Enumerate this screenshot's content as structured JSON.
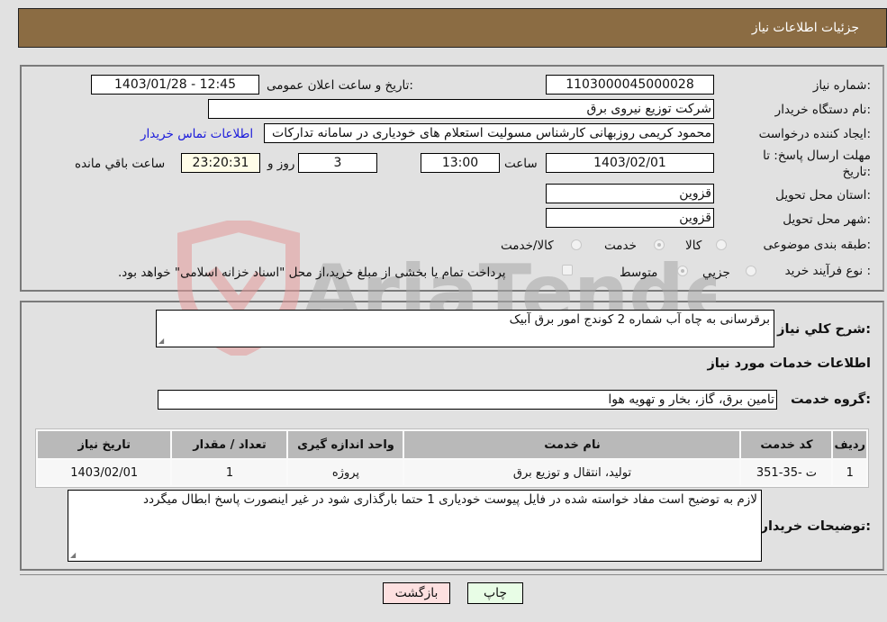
{
  "header": {
    "title": "جزئیات اطلاعات نیاز"
  },
  "fields": {
    "need_number": {
      "label": "شماره نیاز:",
      "value": "1103000045000028"
    },
    "announce_datetime": {
      "label": "تاریخ و ساعت اعلان عمومی:",
      "value": "1403/01/28 - 12:45"
    },
    "buyer_org": {
      "label": "نام دستگاه خریدار:",
      "value": "شرکت توزیع نیروی برق"
    },
    "requester": {
      "label": "ایجاد کننده درخواست:",
      "value": "محمود کریمی روزبهانی کارشناس  مسولیت استعلام های خودیاری در سامانه تدارکات",
      "link": "اطلاعات تماس خریدار"
    },
    "deadline": {
      "label": "مهلت ارسال پاسخ: تا تاریخ:",
      "date": "1403/02/01",
      "time_label": "ساعت",
      "time": "13:00",
      "days": "3",
      "days_label": "روز و",
      "remaining": "23:20:31",
      "remaining_label": "ساعت باقي مانده"
    },
    "province": {
      "label": "استان محل تحویل:",
      "value": "قزوین"
    },
    "city": {
      "label": "شهر محل تحویل:",
      "value": "قزوین"
    },
    "category": {
      "label": "طبقه بندی موضوعی:",
      "options": [
        {
          "label": "کالا",
          "checked": false
        },
        {
          "label": "خدمت",
          "checked": true
        },
        {
          "label": "کالا/خدمت",
          "checked": false
        }
      ]
    },
    "purchase_type": {
      "label": "نوع فرآیند خرید :",
      "options": [
        {
          "label": "جزيي",
          "checked": false
        },
        {
          "label": "متوسط",
          "checked": true
        }
      ],
      "checkbox_label": "پرداخت تمام یا بخشی از مبلغ خرید،از محل \"اسناد خزانه اسلامی\" خواهد بود.",
      "checkbox_checked": false
    }
  },
  "summary": {
    "label": "شرح کلي نیاز:",
    "value": "برقرسانی به چاه آب شماره 2 کوندج امور برق آبیک"
  },
  "services_title": "اطلاعات خدمات مورد نیاز",
  "service_group": {
    "label": "گروه خدمت:",
    "value": "تامین برق، گاز، بخار و تهویه هوا"
  },
  "table": {
    "headers": [
      "ردیف",
      "کد خدمت",
      "نام خدمت",
      "واحد اندازه گیری",
      "تعداد / مقدار",
      "تاریخ نیاز"
    ],
    "rows": [
      [
        "1",
        "ت -35-351",
        "تولید، انتقال و توزیع برق",
        "پروژه",
        "1",
        "1403/02/01"
      ]
    ]
  },
  "buyer_notes": {
    "label": "توضیحات خریدار:",
    "value": "لازم به توضیح است مفاد خواسته شده در فایل پیوست خودیاری 1 حتما بارگذاری شود در غیر اینصورت پاسخ ابطال میگردد"
  },
  "buttons": {
    "print": "چاپ",
    "back": "بازگشت"
  },
  "watermark": "AriaTender.neT",
  "colors": {
    "header": "#8b6c43",
    "link": "#1a1adb",
    "print_bg": "#e8fde6",
    "back_bg": "#fde0e0",
    "remaining_bg": "#fffde8"
  }
}
